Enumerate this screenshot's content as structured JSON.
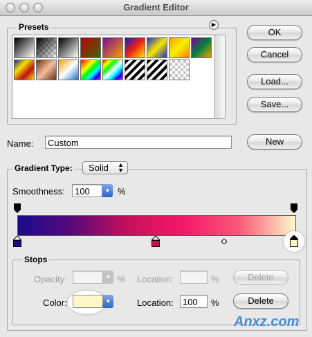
{
  "window": {
    "title": "Gradient Editor"
  },
  "presets": {
    "label": "Presets"
  },
  "buttons": {
    "ok": "OK",
    "cancel": "Cancel",
    "load": "Load...",
    "save": "Save...",
    "new": "New",
    "delete": "Delete"
  },
  "name": {
    "label": "Name:",
    "value": "Custom"
  },
  "gradient_type": {
    "label": "Gradient Type:",
    "value": "Solid"
  },
  "smoothness": {
    "label": "Smoothness:",
    "value": "100",
    "unit": "%"
  },
  "stops": {
    "label": "Stops",
    "opacity_label": "Opacity:",
    "opacity_value": "",
    "opacity_unit": "%",
    "location_label": "Location:",
    "location_top_value": "",
    "location_top_unit": "%",
    "color_label": "Color:",
    "color_value": "#fcf8c8",
    "location_bottom_value": "100",
    "location_bottom_unit": "%"
  },
  "gradient": {
    "colors": [
      "#1a0a8c",
      "#5a0a7a",
      "#c8105a",
      "#f5186a",
      "#fa5a7a",
      "#fcf8c8"
    ]
  },
  "watermark": "Anxz.com"
}
